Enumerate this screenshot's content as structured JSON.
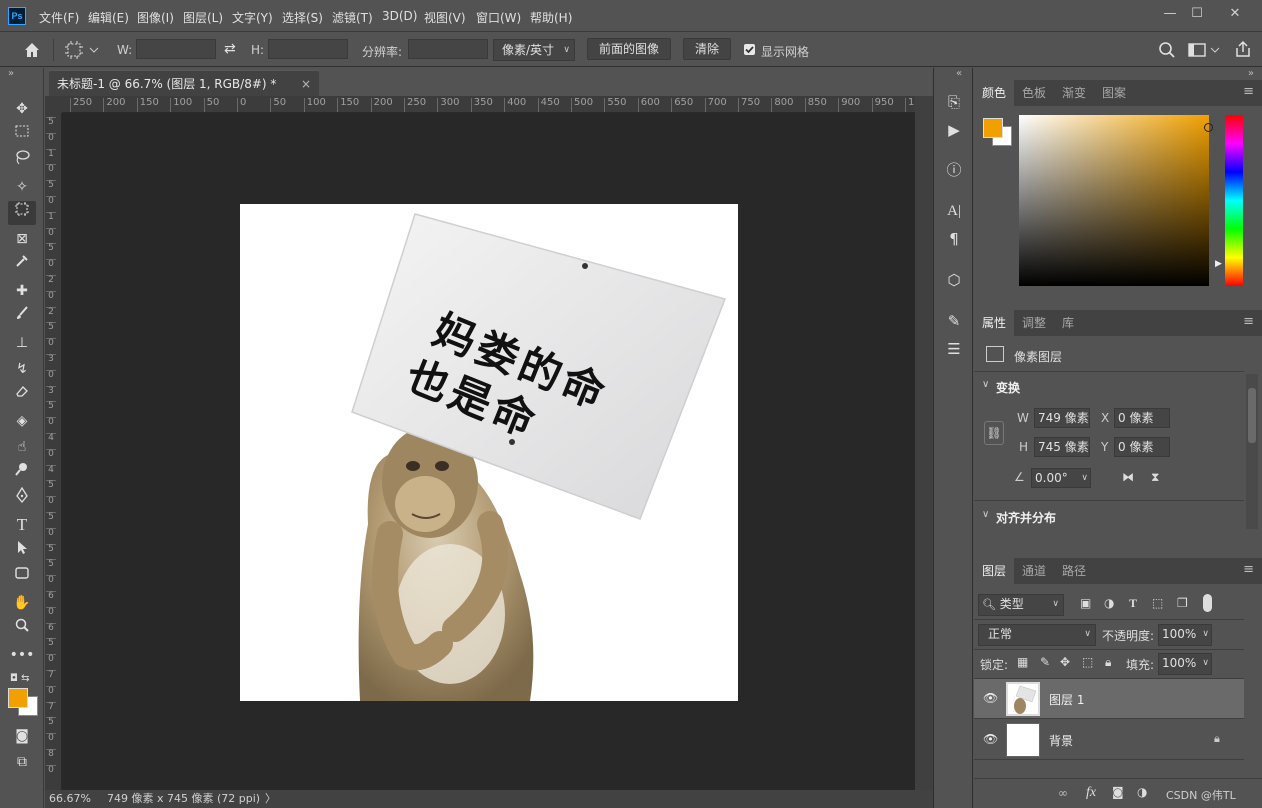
{
  "app": {
    "logo": "Ps",
    "window_buttons": [
      "—",
      "☐",
      "✕"
    ]
  },
  "menu": [
    "文件(F)",
    "编辑(E)",
    "图像(I)",
    "图层(L)",
    "文字(Y)",
    "选择(S)",
    "滤镜(T)",
    "3D(D)",
    "视图(V)",
    "窗口(W)",
    "帮助(H)"
  ],
  "options": {
    "w_label": "W:",
    "h_label": "H:",
    "resolution_label": "分辨率:",
    "unit_select": "像素/英寸",
    "front_image_button": "前面的图像",
    "clear_button": "清除",
    "show_grid_label": "显示网格"
  },
  "document": {
    "tab_title": "未标题-1 @ 66.7% (图层 1, RGB/8#) *",
    "close": "×",
    "sign_line1": "妈娄的命",
    "sign_line2": "也是命",
    "ruler_top": [
      "250",
      "200",
      "150",
      "100",
      "50",
      "0",
      "50",
      "100",
      "150",
      "200",
      "250",
      "300",
      "350",
      "400",
      "450",
      "500",
      "550",
      "600",
      "650",
      "700",
      "750",
      "800",
      "850",
      "900",
      "950",
      "1"
    ],
    "ruler_left": [
      "5",
      "0",
      "1",
      "0",
      "5",
      "0",
      "1",
      "0",
      "5",
      "0",
      "2",
      "0",
      "2",
      "5",
      "0",
      "3",
      "0",
      "3",
      "5",
      "0",
      "4",
      "0",
      "4",
      "5",
      "0",
      "5",
      "0",
      "5",
      "5",
      "0",
      "6",
      "0",
      "6",
      "5",
      "0",
      "7",
      "0",
      "7",
      "5",
      "0",
      "8",
      "0"
    ]
  },
  "status": {
    "zoom": "66.67%",
    "size_info": "749 像素 x 745 像素 (72 ppi)",
    "arrow": "〉"
  },
  "colors": {
    "foreground": "#f0a000",
    "background": "#ffffff",
    "accent": "#31a8ff"
  },
  "color_panel": {
    "tabs": [
      "颜色",
      "色板",
      "渐变",
      "图案"
    ]
  },
  "properties_panel": {
    "tabs": [
      "属性",
      "调整",
      "库"
    ],
    "type_label": "像素图层",
    "transform_header": "变换",
    "w_label": "W",
    "w_value": "749 像素",
    "x_label": "X",
    "x_value": "0 像素",
    "h_label": "H",
    "h_value": "745 像素",
    "y_label": "Y",
    "y_value": "0 像素",
    "angle_value": "0.00°",
    "align_header": "对齐并分布"
  },
  "layers_panel": {
    "tabs": [
      "图层",
      "通道",
      "路径"
    ],
    "filter_select": "类型",
    "blend_mode": "正常",
    "opacity_label": "不透明度:",
    "opacity_value": "100%",
    "lock_label": "锁定:",
    "fill_label": "填充:",
    "fill_value": "100%",
    "layers": [
      {
        "name": "图层 1"
      },
      {
        "name": "背景"
      }
    ],
    "fx_label": "fx",
    "watermark": "CSDN @伟TL"
  }
}
